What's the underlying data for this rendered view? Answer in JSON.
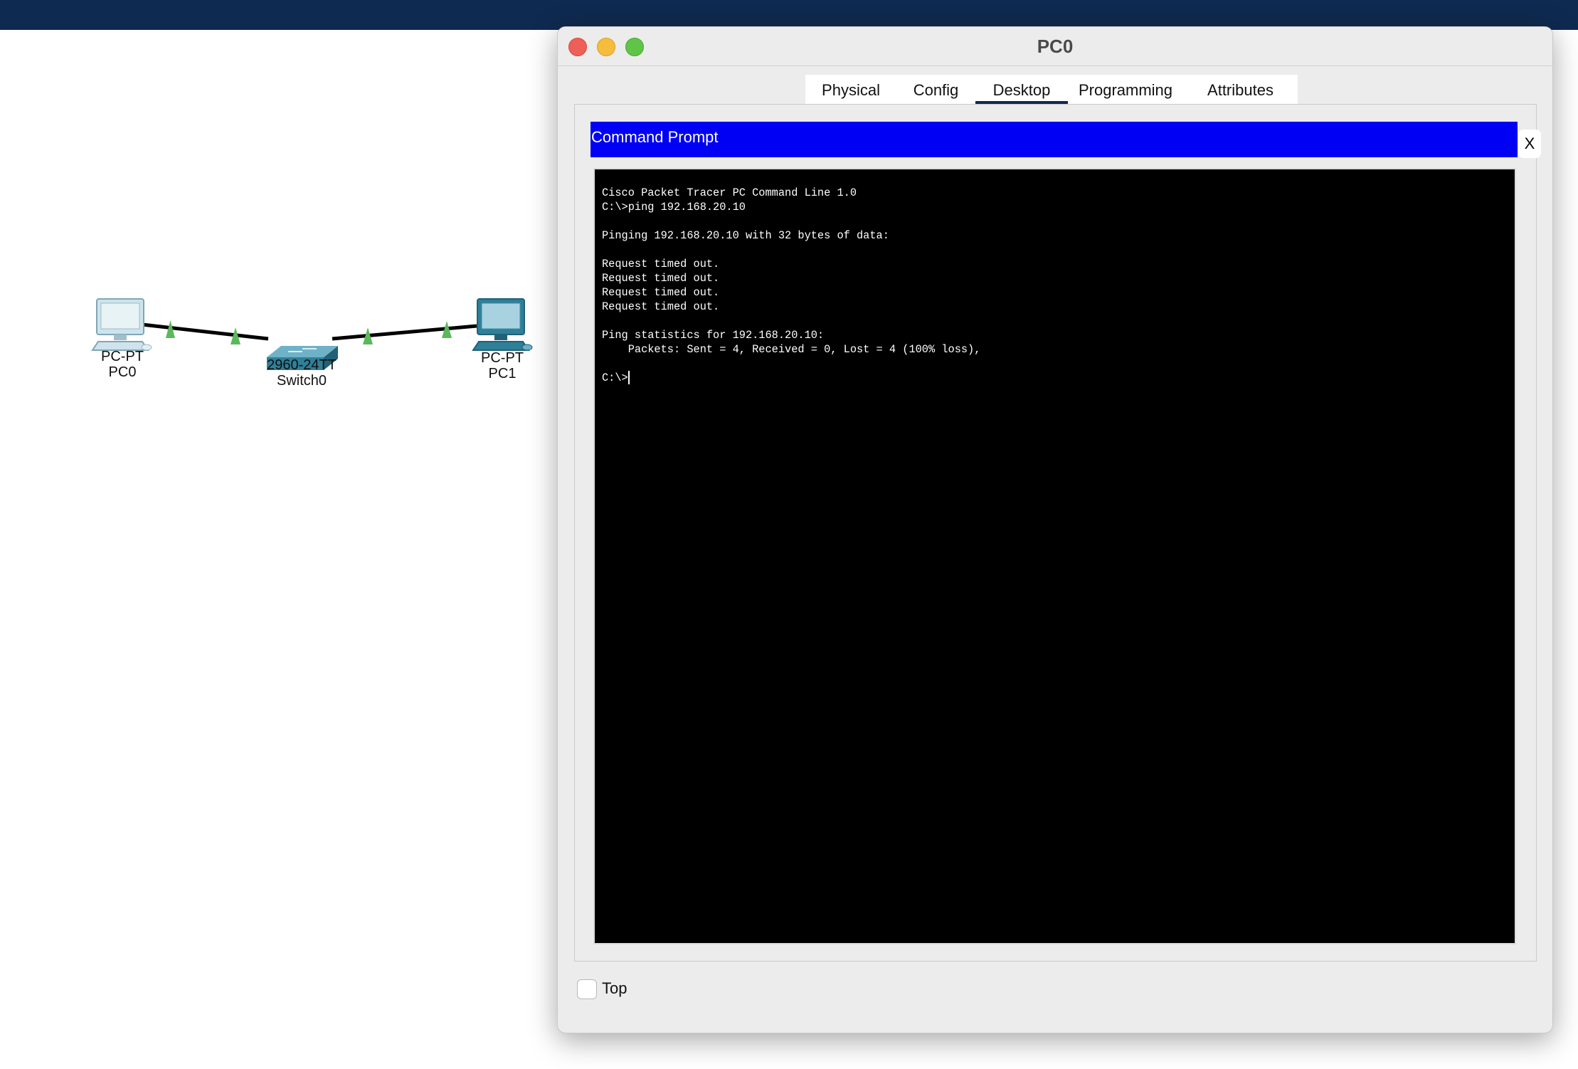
{
  "topology": {
    "devices": [
      {
        "model": "PC-PT",
        "name": "PC0"
      },
      {
        "model": "2960-24TT",
        "name": "Switch0"
      },
      {
        "model": "PC-PT",
        "name": "PC1"
      }
    ],
    "link_status_color": "#5cb85c"
  },
  "dialog": {
    "title": "PC0",
    "tabs": [
      "Physical",
      "Config",
      "Desktop",
      "Programming",
      "Attributes"
    ],
    "active_tab": "Desktop",
    "command_prompt": {
      "title": "Command Prompt",
      "close_label": "X",
      "header_color": "#0000f5",
      "output": "Cisco Packet Tracer PC Command Line 1.0\nC:\\>ping 192.168.20.10\n\nPinging 192.168.20.10 with 32 bytes of data:\n\nRequest timed out.\nRequest timed out.\nRequest timed out.\nRequest timed out.\n\nPing statistics for 192.168.20.10:\n    Packets: Sent = 4, Received = 0, Lost = 4 (100% loss),\n\nC:\\>"
    },
    "top_checkbox": {
      "label": "Top",
      "checked": false
    }
  }
}
